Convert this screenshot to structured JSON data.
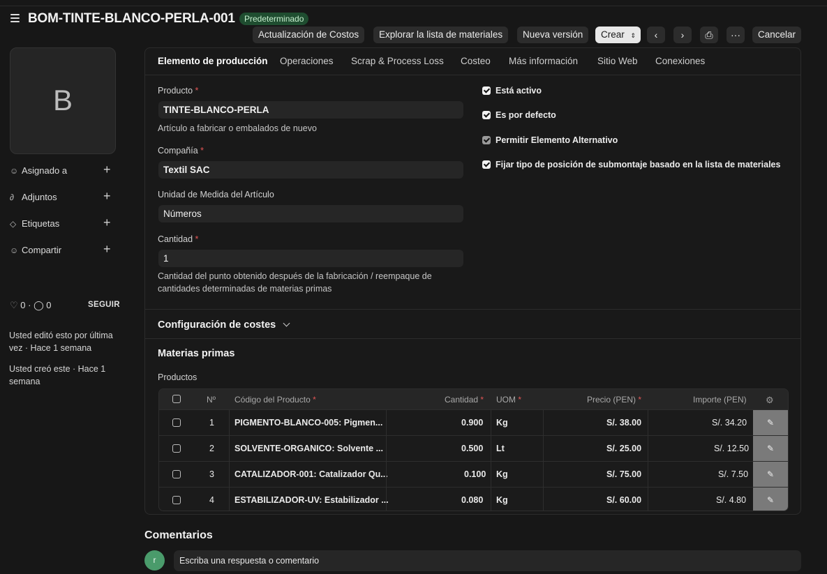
{
  "header": {
    "title": "BOM-TINTE-BLANCO-PERLA-001",
    "status_badge": "Predeterminado",
    "buttons": {
      "update_costs": "Actualización de Costos",
      "explore_bom": "Explorar la lista de materiales",
      "new_version": "Nueva versión",
      "create": "Crear",
      "prev": "‹",
      "next": "›",
      "print": "⎙",
      "more": "···",
      "cancel": "Cancelar"
    }
  },
  "sidebar": {
    "avatar_letter": "B",
    "items": [
      {
        "label": "Asignado a",
        "icon": "user-plus-icon"
      },
      {
        "label": "Adjuntos",
        "icon": "paperclip-icon"
      },
      {
        "label": "Etiquetas",
        "icon": "tag-icon"
      },
      {
        "label": "Compartir",
        "icon": "share-user-icon"
      }
    ],
    "likes": "0",
    "comments": "0",
    "follow": "SEGUIR",
    "edited": "Usted editó esto por última vez · Hace 1 semana",
    "created": "Usted creó este · Hace 1 semana"
  },
  "tabs": [
    "Elemento de producción",
    "Operaciones",
    "Scrap & Process Loss",
    "Costeo",
    "Más información",
    "Sitio Web",
    "Conexiones"
  ],
  "form": {
    "producto_label": "Producto",
    "producto_value": "TINTE-BLANCO-PERLA",
    "producto_help": "Artículo a fabricar o embalados de nuevo",
    "compania_label": "Compañía",
    "compania_value": "Textil SAC",
    "uom_label": "Unidad de Medida del Artículo",
    "uom_value": "Números",
    "cantidad_label": "Cantidad",
    "cantidad_value": "1",
    "cantidad_help": "Cantidad del punto obtenido después de la fabricación / reempaque de cantidades determinadas de materias primas",
    "required_mark": "*"
  },
  "checks": [
    {
      "label": "Está activo",
      "checked": true
    },
    {
      "label": "Es por defecto",
      "checked": true
    },
    {
      "label": "Permitir Elemento Alternativo",
      "checked": true
    },
    {
      "label": "Fijar tipo de posición de submontaje basado en la lista de materiales",
      "checked": true
    }
  ],
  "sections": {
    "costing": "Configuración de costes",
    "raw_materials": "Materias primas",
    "products_label": "Productos"
  },
  "table": {
    "headers": {
      "no": "Nº",
      "code": "Código del Producto",
      "qty": "Cantidad",
      "uom": "UOM",
      "price": "Precio (PEN)",
      "amount": "Importe (PEN)"
    },
    "rows": [
      {
        "no": "1",
        "code": "PIGMENTO-BLANCO-005: Pigmen...",
        "qty": "0.900",
        "uom": "Kg",
        "price": "S/. 38.00",
        "amount": "S/. 34.20"
      },
      {
        "no": "2",
        "code": "SOLVENTE-ORGANICO: Solvente ...",
        "qty": "0.500",
        "uom": "Lt",
        "price": "S/. 25.00",
        "amount": "S/. 12.50"
      },
      {
        "no": "3",
        "code": "CATALIZADOR-001: Catalizador Qu...",
        "qty": "0.100",
        "uom": "Kg",
        "price": "S/. 75.00",
        "amount": "S/. 7.50"
      },
      {
        "no": "4",
        "code": "ESTABILIZADOR-UV: Estabilizador ...",
        "qty": "0.080",
        "uom": "Kg",
        "price": "S/. 60.00",
        "amount": "S/. 4.80"
      }
    ]
  },
  "comments": {
    "title": "Comentarios",
    "avatar_letter": "r",
    "placeholder": "Escriba una respuesta o comentario"
  },
  "colors": {
    "badge_bg": "#1f4d30",
    "avatar_comment": "#4a9b6b",
    "required": "#e25555"
  }
}
